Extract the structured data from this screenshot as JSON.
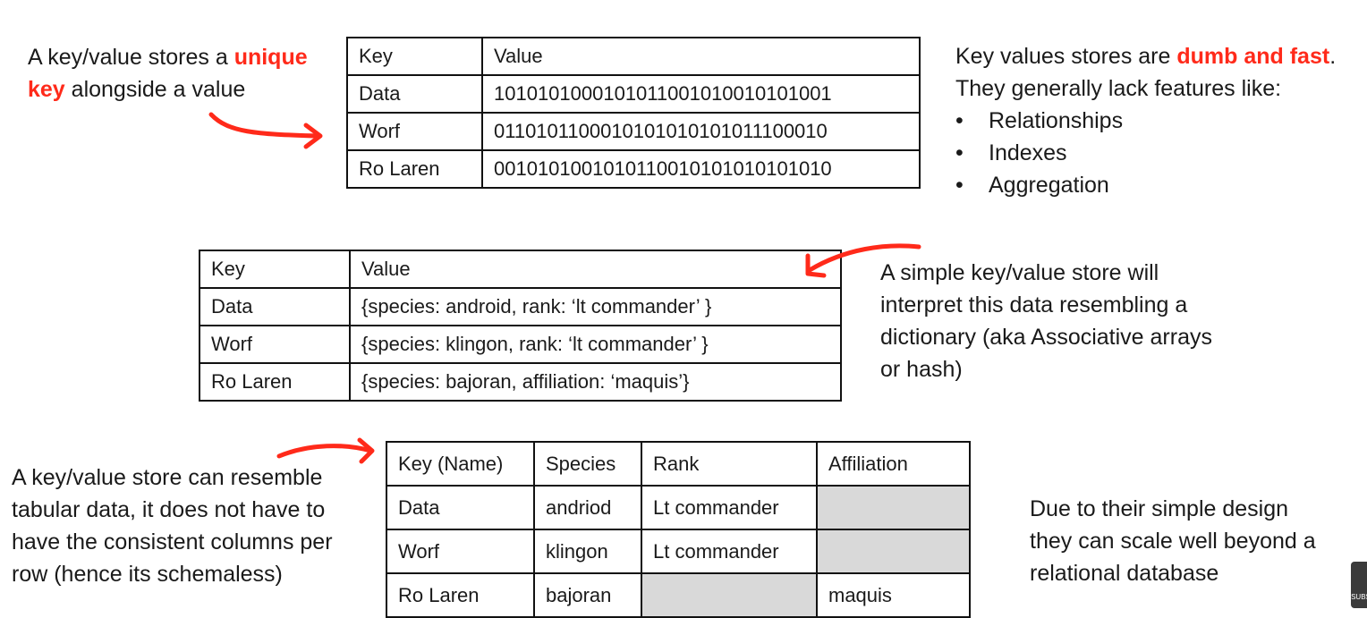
{
  "intro": {
    "prefix": "A key/value stores a ",
    "highlight_1": "unique",
    "highlight_2": "key",
    "suffix": " alongside a value"
  },
  "table1": {
    "header": [
      "Key",
      "Value"
    ],
    "rows": [
      [
        "Data",
        "10101010001010110010100101010 01"
      ],
      [
        "Worf",
        "01101011000101010101010111000 10"
      ],
      [
        "Ro Laren",
        "00101010010101100101010101010 10"
      ]
    ]
  },
  "features": {
    "line1_prefix": "Key values stores are ",
    "line1_highlight": "dumb and fast",
    "line1_suffix": ".",
    "line2": "They generally lack features like:",
    "items": [
      "Relationships",
      "Indexes",
      "Aggregation"
    ]
  },
  "table2": {
    "header": [
      "Key",
      "Value"
    ],
    "rows": [
      [
        "Data",
        "{species: android, rank: ‘lt commander’ }"
      ],
      [
        "Worf",
        "{species: klingon, rank: ‘lt commander’ }"
      ],
      [
        "Ro Laren",
        "{species: bajoran, affiliation: ‘maquis’}"
      ]
    ]
  },
  "dictionary_note": [
    "A simple key/value store will",
    "interpret this data resembling a",
    "dictionary (aka Associative arrays",
    "or hash)"
  ],
  "tabular_note": [
    "A key/value store can resemble",
    "tabular data, it does not have to",
    "have the consistent columns per",
    "row (hence its schemaless)"
  ],
  "table3": {
    "header": [
      "Key (Name)",
      "Species",
      "Rank",
      "Affiliation"
    ],
    "rows": [
      [
        "Data",
        "andriod",
        "Lt commander",
        ""
      ],
      [
        "Worf",
        "klingon",
        "Lt commander",
        ""
      ],
      [
        "Ro Laren",
        "bajoran",
        "",
        "maquis"
      ]
    ]
  },
  "scale_note": [
    "Due to their simple design",
    "they can scale well beyond a",
    "relational database"
  ],
  "annotation_color": "#ff2a1a",
  "corner_logo_text": "SUBS"
}
